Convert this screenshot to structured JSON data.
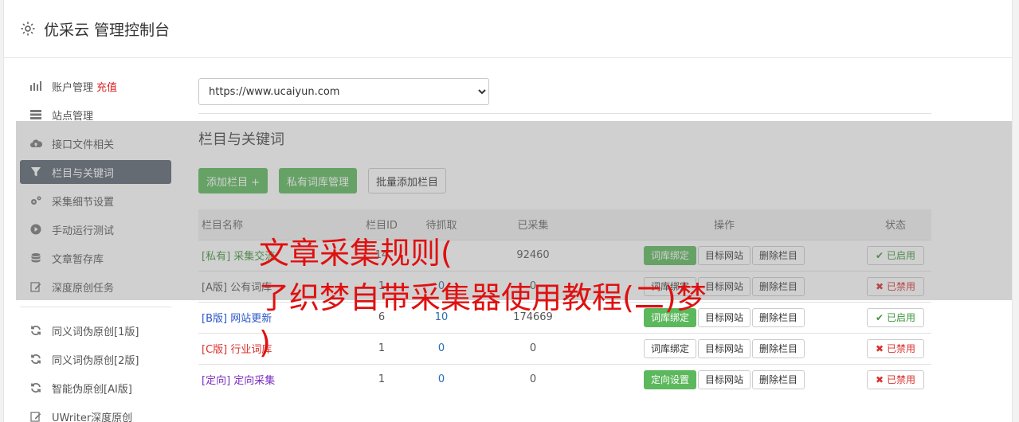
{
  "header": {
    "title": "优采云 管理控制台",
    "icon": "gear-icon"
  },
  "sidebar": {
    "items": [
      {
        "label": "账户管理",
        "extra": "充值",
        "icon": "bar-chart-icon"
      },
      {
        "label": "站点管理",
        "icon": "server-icon"
      },
      {
        "label": "接口文件相关",
        "icon": "cloud-upload-icon"
      },
      {
        "label": "栏目与关键词",
        "icon": "filter-icon",
        "active": true
      },
      {
        "label": "采集细节设置",
        "icon": "cogs-icon"
      },
      {
        "label": "手动运行测试",
        "icon": "play-icon"
      },
      {
        "label": "文章暂存库",
        "icon": "database-icon"
      },
      {
        "label": "深度原创任务",
        "icon": "edit-icon"
      }
    ],
    "items2": [
      {
        "label": "同义词伪原创[1版]",
        "icon": "refresh-icon"
      },
      {
        "label": "同义词伪原创[2版]",
        "icon": "refresh-icon"
      },
      {
        "label": "智能伪原创[AI版]",
        "icon": "refresh-icon"
      },
      {
        "label": "UWriter深度原创",
        "icon": "edit-icon"
      }
    ]
  },
  "site_select": {
    "value": "https://www.ucaiyun.com"
  },
  "section": {
    "title": "栏目与关键词"
  },
  "buttons": {
    "add": "添加栏目 +",
    "private_lib": "私有词库管理",
    "batch_add": "批量添加栏目"
  },
  "table": {
    "headers": [
      "栏目名称",
      "栏目ID",
      "待抓取",
      "已采集",
      "操作",
      "状态"
    ],
    "rows": [
      {
        "name": "[私有] 采集交流",
        "id": "14",
        "pending": "",
        "collected": "92460",
        "op1": "词库绑定",
        "op2": "目标网站",
        "op3": "删除栏目",
        "status": "已启用",
        "on": true,
        "nameColor": "#3c963c"
      },
      {
        "name": "[A版] 公有词库",
        "id": "1",
        "pending": "0",
        "collected": "0",
        "op1": "词库绑定",
        "op2": "目标网站",
        "op3": "删除栏目",
        "status": "已禁用",
        "on": false,
        "nameColor": "#555555"
      },
      {
        "name": "[B版] 网站更新",
        "id": "6",
        "pending": "10",
        "collected": "174669",
        "op1": "词库绑定",
        "op2": "目标网站",
        "op3": "删除栏目",
        "status": "已启用",
        "on": true,
        "nameColor": "#2a55c8"
      },
      {
        "name": "[C版] 行业词库",
        "id": "1",
        "pending": "0",
        "collected": "0",
        "op1": "词库绑定",
        "op2": "目标网站",
        "op3": "删除栏目",
        "status": "已禁用",
        "on": false,
        "nameColor": "#d9302c"
      },
      {
        "name": "[定向] 定向采集",
        "id": "1",
        "pending": "0",
        "collected": "0",
        "op1": "定向设置",
        "op2": "目标网站",
        "op3": "删除栏目",
        "status": "已禁用",
        "on": false,
        "nameColor": "#7a2fc0"
      }
    ]
  },
  "overlay": {
    "line1": "文章采集规则(",
    "line2": "了织梦自带采集器使用教程(二)梦",
    "line3": ")"
  },
  "colors": {
    "accent_green": "#5cb85c",
    "sidebar_active": "#5b6470",
    "overlay_red": "#e01010"
  }
}
